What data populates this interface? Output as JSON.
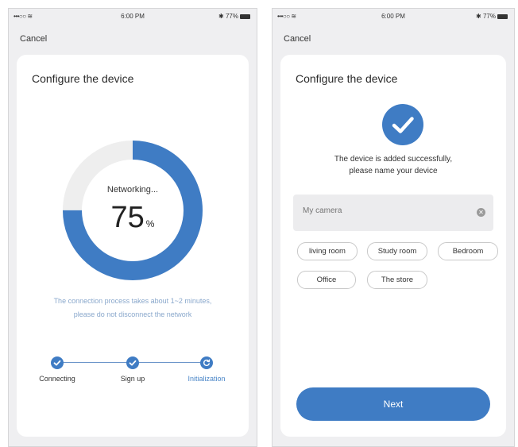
{
  "status_bar": {
    "signal": "•••○○",
    "wifi_icon": "wifi-icon",
    "time": "6:00 PM",
    "battery": "77%"
  },
  "screen1": {
    "cancel": "Cancel",
    "title": "Configure the device",
    "progress_label": "Networking...",
    "progress_value": "75",
    "progress_unit": "%",
    "progress_fraction": 0.75,
    "hint_line1": "The connection process takes about 1~2 minutes,",
    "hint_line2": "please do not disconnect the network",
    "steps": [
      {
        "label": "Connecting",
        "state": "done"
      },
      {
        "label": "Sign up",
        "state": "done"
      },
      {
        "label": "Initialization",
        "state": "in-progress"
      }
    ]
  },
  "screen2": {
    "cancel": "Cancel",
    "title": "Configure the device",
    "message_line1": "The device is added successfully,",
    "message_line2": "please name your device",
    "input_placeholder": "My camera",
    "chips": [
      "living room",
      "Study room",
      "Bedroom",
      "Office",
      "The store"
    ],
    "next": "Next"
  },
  "colors": {
    "accent": "#3f7cc4",
    "ring_track": "#eeeeee",
    "hint": "#8aa8cc",
    "background": "#efeff1"
  }
}
